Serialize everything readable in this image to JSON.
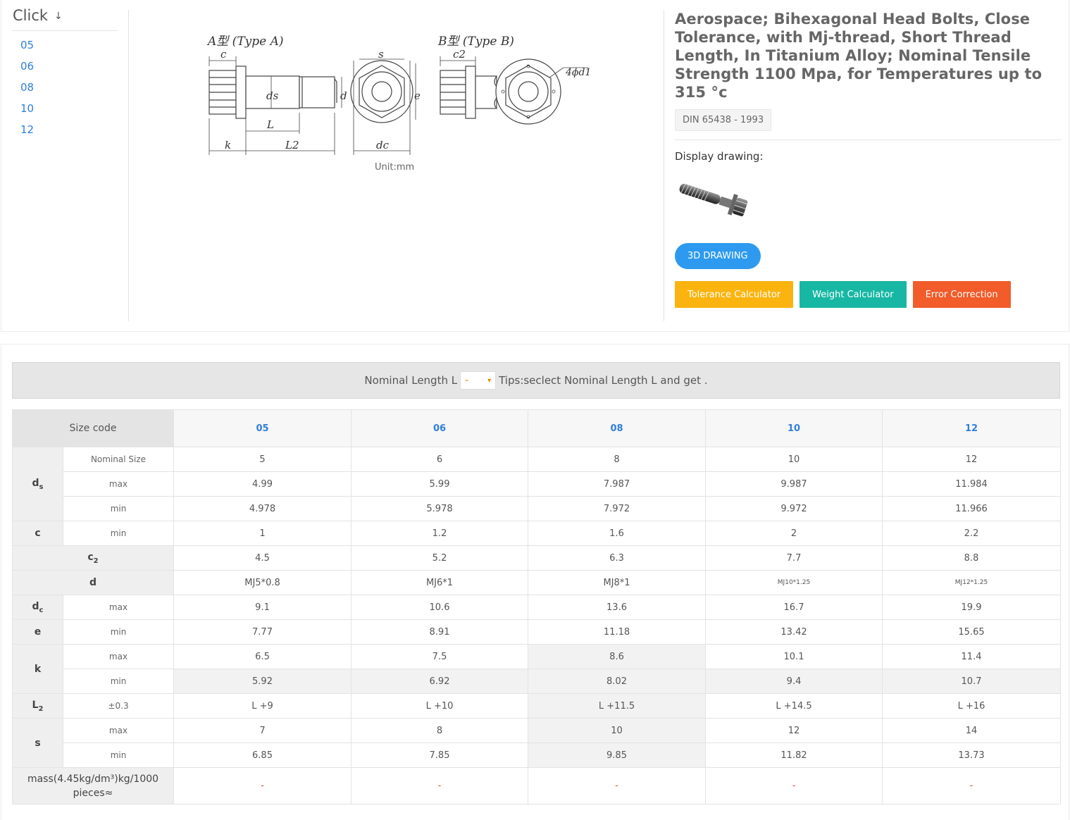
{
  "nav": {
    "title": "Click",
    "items": [
      "05",
      "06",
      "08",
      "10",
      "12"
    ]
  },
  "drawing": {
    "type_a_label": "A型 (Type A)",
    "type_b_label": "B型 (Type B)",
    "unit": "Unit:mm",
    "dims": [
      "c",
      "s",
      "c2",
      "4ϕd1",
      "ds",
      "d",
      "e",
      "L",
      "k",
      "L2",
      "dc"
    ]
  },
  "product": {
    "title": "Aerospace; Bihexagonal Head Bolts, Close Tolerance, with Mj-thread, Short Thread Length, In Titanium Alloy; Nominal Tensile Strength 1100 Mpa, for Temperatures up to 315 °c",
    "standard": "DIN 65438 - 1993",
    "display_label": "Display drawing:",
    "btn_3d": "3D DRAWING",
    "btn_tolerance": "Tolerance Calculator",
    "btn_weight": "Weight Calculator",
    "btn_error": "Error Correction",
    "colors": {
      "3d": "#2d9af0",
      "tolerance": "#fbb40f",
      "weight": "#17b7a4",
      "error": "#f25b2a"
    }
  },
  "length_bar": {
    "label": "Nominal Length L",
    "selected": "-",
    "tips": "Tips:seclect Nominal Length L and get ."
  },
  "table": {
    "size_code_label": "Size code",
    "sizes": [
      "05",
      "06",
      "08",
      "10",
      "12"
    ],
    "ds_label": "ds",
    "ds_nominal_label": "Nominal Size",
    "ds_nominal": [
      "5",
      "6",
      "8",
      "10",
      "12"
    ],
    "ds_max_label": "max",
    "ds_max": [
      "4.99",
      "5.99",
      "7.987",
      "9.987",
      "11.984"
    ],
    "ds_min_label": "min",
    "ds_min": [
      "4.978",
      "5.978",
      "7.972",
      "9.972",
      "11.966"
    ],
    "c_label": "c",
    "c_min_label": "min",
    "c_min": [
      "1",
      "1.2",
      "1.6",
      "2",
      "2.2"
    ],
    "c2_label": "c2",
    "c2": [
      "4.5",
      "5.2",
      "6.3",
      "7.7",
      "8.8"
    ],
    "d_label": "d",
    "d": [
      "MJ5*0.8",
      "MJ6*1",
      "MJ8*1",
      "MJ10*1.25",
      "MJ12*1.25"
    ],
    "dc_label": "dc",
    "dc_max_label": "max",
    "dc_max": [
      "9.1",
      "10.6",
      "13.6",
      "16.7",
      "19.9"
    ],
    "e_label": "e",
    "e_min_label": "min",
    "e_min": [
      "7.77",
      "8.91",
      "11.18",
      "13.42",
      "15.65"
    ],
    "k_label": "k",
    "k_max_label": "max",
    "k_max": [
      "6.5",
      "7.5",
      "8.6",
      "10.1",
      "11.4"
    ],
    "k_min_label": "min",
    "k_min": [
      "5.92",
      "6.92",
      "8.02",
      "9.4",
      "10.7"
    ],
    "L2_label": "L2",
    "L2_tol_label": "±0.3",
    "L2": [
      "L +9",
      "L +10",
      "L +11.5",
      "L +14.5",
      "L +16"
    ],
    "s_label": "s",
    "s_max_label": "max",
    "s_max": [
      "7",
      "8",
      "10",
      "12",
      "14"
    ],
    "s_min_label": "min",
    "s_min": [
      "6.85",
      "7.85",
      "9.85",
      "11.82",
      "13.73"
    ],
    "mass_label": "mass(4.45kg/dm³)kg/1000 pieces≈",
    "mass": [
      "-",
      "-",
      "-",
      "-",
      "-"
    ]
  }
}
